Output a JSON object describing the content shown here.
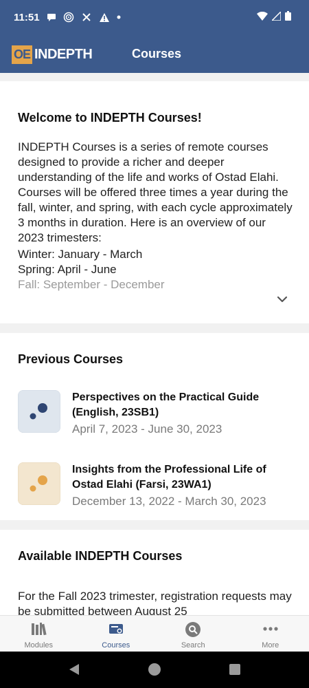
{
  "status_bar": {
    "time": "11:51"
  },
  "app_bar": {
    "logo_mark": "OE",
    "logo_text": "INDEPTH",
    "title": "Courses"
  },
  "welcome": {
    "heading": "Welcome to INDEPTH Courses!",
    "intro": "INDEPTH Courses is a series of remote courses designed to provide a richer and deeper understanding of the life and works of Ostad Elahi. Courses will be offered three times a year during the fall, winter, and spring, with each cycle approximately 3 months in duration. Here is an overview of our 2023 trimesters:",
    "winter": "Winter: January - March",
    "spring": "Spring: April - June",
    "fall": "Fall: September - December"
  },
  "previous": {
    "heading": "Previous Courses",
    "courses": [
      {
        "title": "Perspectives on the Practical Guide (English, 23SB1)",
        "dates": "April 7, 2023 - June 30, 2023",
        "icon": "blue-dots-thumbnail"
      },
      {
        "title": "Insights from the Professional Life of Ostad Elahi (Farsi, 23WA1)",
        "dates": "December 13, 2022 - March 30, 2023",
        "icon": "orange-dots-thumbnail"
      }
    ]
  },
  "available": {
    "heading": "Available INDEPTH Courses",
    "body": "For the Fall 2023 trimester, registration requests may be submitted between August 25"
  },
  "tabs": [
    {
      "label": "Modules",
      "icon": "books-icon"
    },
    {
      "label": "Courses",
      "icon": "courses-icon",
      "active": true
    },
    {
      "label": "Search",
      "icon": "search-icon"
    },
    {
      "label": "More",
      "icon": "more-icon"
    }
  ],
  "colors": {
    "primary": "#3c5a8c",
    "accent": "#e4a44a",
    "blue_thumb": "#dfe6ee",
    "orange_thumb": "#f3e6cf"
  }
}
